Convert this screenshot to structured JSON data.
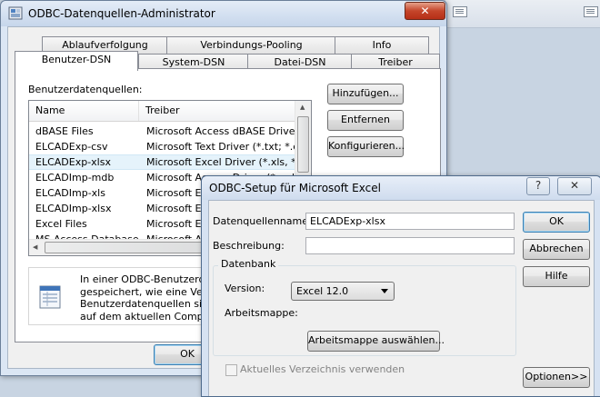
{
  "background": {
    "strip_color": "#e2e8f0"
  },
  "main_window": {
    "title": "ODBC-Datenquellen-Administrator",
    "close_glyph": "✕",
    "tabs_row1": [
      "Ablaufverfolgung",
      "Verbindungs-Pooling",
      "Info"
    ],
    "tabs_row2": [
      "Benutzer-DSN",
      "System-DSN",
      "Datei-DSN",
      "Treiber"
    ],
    "active_tab": "Benutzer-DSN",
    "list_label": "Benutzerdatenquellen:",
    "columns": [
      "Name",
      "Treiber"
    ],
    "rows": [
      {
        "name": "dBASE Files",
        "driver": "Microsoft Access dBASE Driver (*.d"
      },
      {
        "name": "ELCADExp-csv",
        "driver": "Microsoft Text Driver (*.txt; *.csv)"
      },
      {
        "name": "ELCADExp-xlsx",
        "driver": "Microsoft Excel Driver (*.xls, *.xlsx,"
      },
      {
        "name": "ELCADImp-mdb",
        "driver": "Microsoft Access Driver (*.mdb)"
      },
      {
        "name": "ELCADImp-xls",
        "driver": "Microsoft Exc"
      },
      {
        "name": "ELCADImp-xlsx",
        "driver": "Microsoft Exc"
      },
      {
        "name": "Excel Files",
        "driver": "Microsoft Exc"
      },
      {
        "name": "MS Access Database",
        "driver": "Microsoft Acc"
      }
    ],
    "selected_row": "ELCADExp-xlsx",
    "buttons": {
      "add": "Hinzufügen...",
      "remove": "Entfernen",
      "configure": "Konfigurieren...",
      "ok": "OK"
    },
    "info_lines": [
      "In einer ODBC-Benutzerdate",
      "gespeichert, wie eine Verbin",
      "Benutzerdatenquellen sind n",
      "auf dem aktuellen Computer"
    ]
  },
  "setup_dialog": {
    "title": "ODBC-Setup für Microsoft Excel",
    "help_glyph": "?",
    "close_glyph": "✕",
    "dsn_label": "Datenquellenname:",
    "dsn_value": "ELCADExp-xlsx",
    "desc_label": "Beschreibung:",
    "desc_value": "",
    "group_label": "Datenbank",
    "version_label": "Version:",
    "version_value": "Excel 12.0",
    "workbook_label": "Arbeitsmappe:",
    "select_workbook_button": "Arbeitsmappe auswählen...",
    "current_dir_checkbox": "Aktuelles Verzeichnis verwenden",
    "current_dir_checked": false,
    "buttons": {
      "ok": "OK",
      "cancel": "Abbrechen",
      "help": "Hilfe",
      "options": "Optionen>>"
    }
  }
}
